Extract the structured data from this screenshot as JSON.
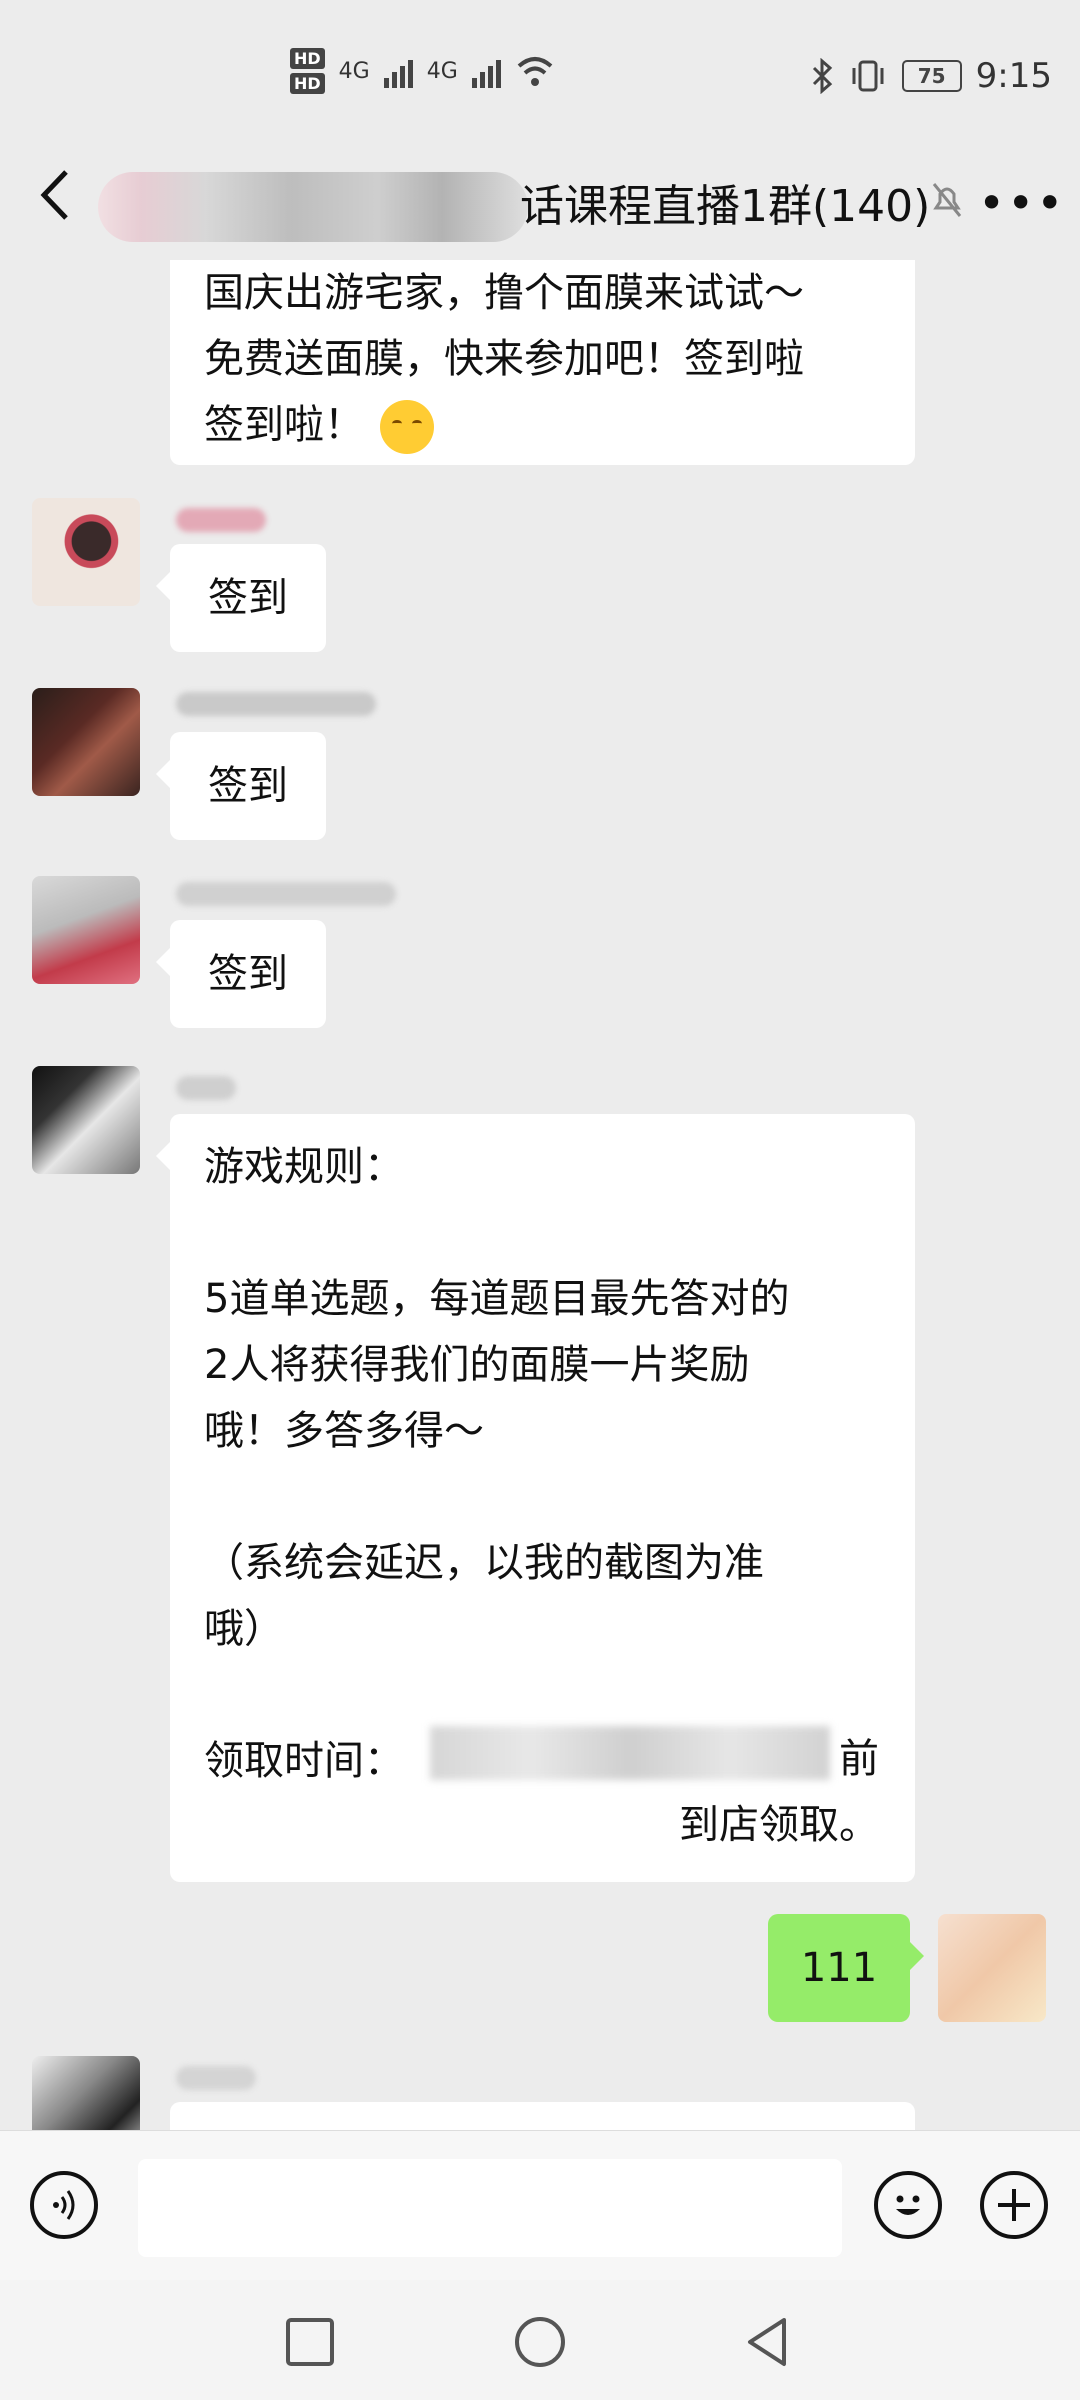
{
  "status_bar": {
    "hd_labels": [
      "HD",
      "HD"
    ],
    "network_labels": [
      "4G",
      "4G"
    ],
    "battery_level": "75",
    "time": "9:15"
  },
  "header": {
    "title": "话课程直播1群(140)",
    "more_label": "•••"
  },
  "messages": [
    {
      "type": "text",
      "side": "left",
      "text": "国庆出游宅家，撸个面膜来试试～\n免费送面膜，快来参加吧！签到啦\n签到啦！",
      "emoji": "relieved-face"
    },
    {
      "type": "text",
      "side": "left",
      "text": "签到"
    },
    {
      "type": "text",
      "side": "left",
      "text": "签到"
    },
    {
      "type": "text",
      "side": "left",
      "text": "签到"
    },
    {
      "type": "text",
      "side": "left",
      "text": "游戏规则：\n\n5道单选题，每道题目最先答对的\n2人将获得我们的面膜一片奖励\n哦！多答多得～\n\n（系统会延迟，以我的截图为准\n哦）\n\n领取时间：",
      "text_end": "前\n到店领取。"
    },
    {
      "type": "text",
      "side": "right",
      "text": "111"
    }
  ],
  "colors": {
    "background": "#ececec",
    "sent_bubble": "#95ec69",
    "received_bubble": "#ffffff"
  },
  "icons": {
    "back": "chevron-left-icon",
    "mute": "bell-off-icon",
    "voice": "voice-icon",
    "emoji": "emoji-icon",
    "add": "plus-icon"
  }
}
